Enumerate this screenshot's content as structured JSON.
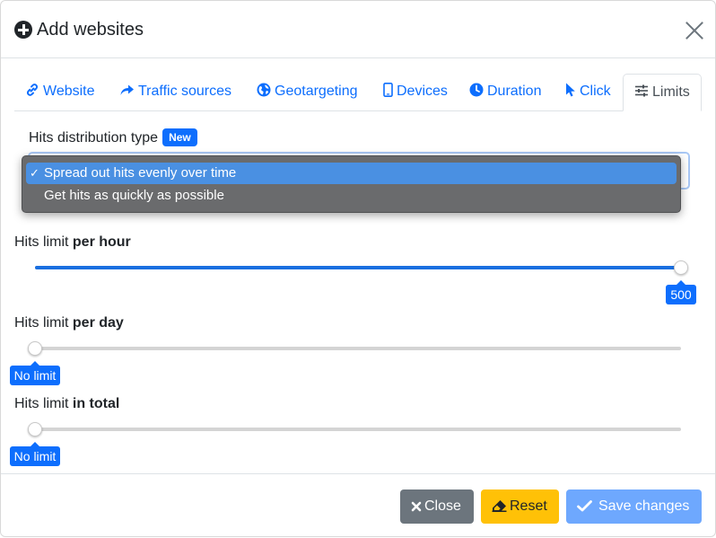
{
  "modal": {
    "title": "Add websites",
    "title_icon": "plus-circle-icon",
    "close_icon": "close-icon"
  },
  "tabs": [
    {
      "label": "Website",
      "icon": "link-icon"
    },
    {
      "label": "Traffic sources",
      "icon": "share-arrow-icon"
    },
    {
      "label": "Geotargeting",
      "icon": "globe-icon"
    },
    {
      "label": "Devices",
      "icon": "mobile-icon"
    },
    {
      "label": "Duration",
      "icon": "clock-icon"
    },
    {
      "label": "Click",
      "icon": "cursor-icon"
    },
    {
      "label": "Limits",
      "icon": "sliders-icon",
      "active": true
    }
  ],
  "distribution": {
    "label": "Hits distribution type",
    "badge": "New",
    "options": [
      {
        "label": "Spread out hits evenly over time",
        "selected": true
      },
      {
        "label": "Get hits as quickly as possible",
        "selected": false
      }
    ],
    "check_mark": "✓"
  },
  "limits": {
    "per_hour": {
      "prefix": "Hits limit ",
      "bold": "per hour",
      "value_label": "500",
      "fraction": 1.0
    },
    "per_day": {
      "prefix": "Hits limit ",
      "bold": "per day",
      "value_label": "No limit",
      "fraction": 0.0
    },
    "in_total": {
      "prefix": "Hits limit ",
      "bold": "in total",
      "value_label": "No limit",
      "fraction": 0.0
    }
  },
  "footer": {
    "close_label": "Close",
    "reset_label": "Reset",
    "save_label": "Save changes"
  },
  "colors": {
    "primary": "#0d6efd",
    "secondary": "#6c757d",
    "warning": "#ffc107",
    "primary_disabled": "#6ea8fe"
  }
}
